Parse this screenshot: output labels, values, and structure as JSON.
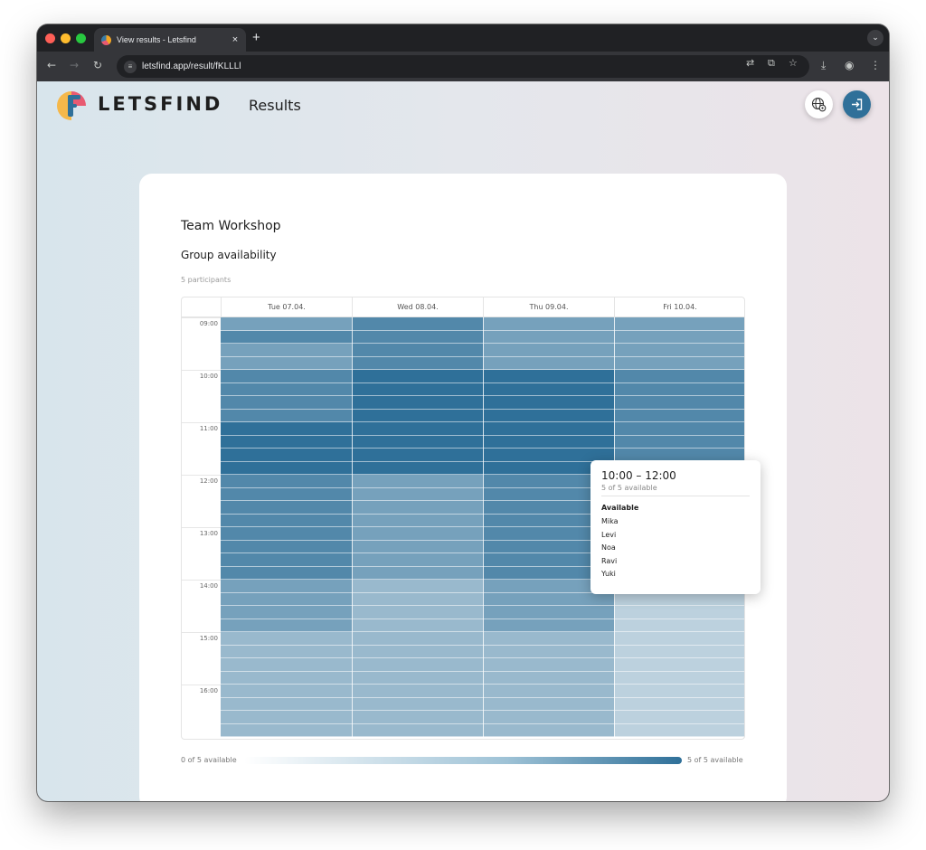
{
  "browser": {
    "tab_title": "View results - Letsfind",
    "tab_close": "×",
    "new_tab": "+",
    "url": "letsfind.app/result/fKLLLl"
  },
  "header": {
    "brand": "LETSFIND",
    "page_title": "Results",
    "icons": [
      "language-settings-icon",
      "login-icon"
    ]
  },
  "event": {
    "title": "Team Workshop",
    "section": "Group availability",
    "participants": "5 participants"
  },
  "grid": {
    "days": [
      "Tue 07.04.",
      "Wed 08.04.",
      "Thu 09.04.",
      "Fri 10.04."
    ],
    "times": [
      "09:00",
      "10:00",
      "11:00",
      "12:00",
      "13:00",
      "14:00",
      "15:00",
      "16:00"
    ],
    "slots_per_hour": 4,
    "total_participants": 5,
    "availability": [
      [
        3,
        4,
        3,
        3,
        4,
        4,
        4,
        4,
        5,
        5,
        5,
        5,
        4,
        4,
        4,
        4,
        4,
        4,
        4,
        4,
        3,
        3,
        3,
        3,
        2,
        2,
        2,
        2,
        2,
        2,
        2,
        2
      ],
      [
        4,
        4,
        4,
        4,
        5,
        5,
        5,
        5,
        5,
        5,
        5,
        5,
        3,
        3,
        3,
        3,
        3,
        3,
        3,
        3,
        2,
        2,
        2,
        2,
        2,
        2,
        2,
        2,
        2,
        2,
        2,
        2
      ],
      [
        3,
        3,
        3,
        3,
        5,
        5,
        5,
        5,
        5,
        5,
        5,
        5,
        4,
        4,
        4,
        4,
        4,
        4,
        4,
        4,
        3,
        3,
        3,
        3,
        2,
        2,
        2,
        2,
        2,
        2,
        2,
        2
      ],
      [
        3,
        3,
        3,
        3,
        4,
        4,
        4,
        4,
        4,
        4,
        4,
        4,
        2,
        2,
        2,
        2,
        2,
        2,
        2,
        2,
        1,
        1,
        1,
        1,
        1,
        1,
        1,
        1,
        1,
        1,
        1,
        1
      ]
    ],
    "color_max": "#2f7099"
  },
  "tooltip": {
    "time_range": "10:00 – 12:00",
    "count": "5 of 5 available",
    "heading": "Available",
    "names": [
      "Mika",
      "Levi",
      "Noa",
      "Ravi",
      "Yuki"
    ]
  },
  "legend": {
    "min_label": "0 of 5 available",
    "max_label": "5 of 5 available"
  }
}
